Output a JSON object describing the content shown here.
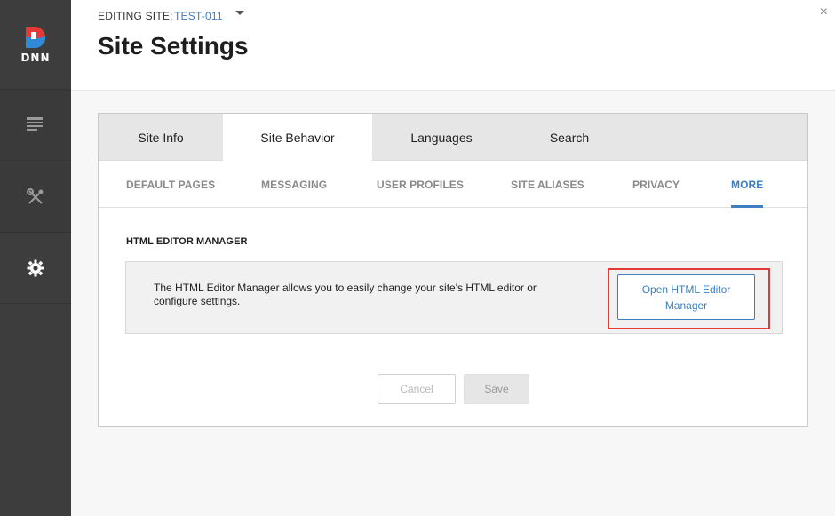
{
  "sidebar": {
    "logo_text": "DNN",
    "items": [
      {
        "icon": "content-list-icon"
      },
      {
        "icon": "tools-icon"
      },
      {
        "icon": "gear-icon"
      }
    ]
  },
  "header": {
    "editing_label": "EDITING SITE:",
    "site_name": "TEST-011",
    "title": "Site Settings",
    "close_glyph": "×"
  },
  "tabs": {
    "main": [
      "Site Info",
      "Site Behavior",
      "Languages",
      "Search"
    ],
    "active_main": "Site Behavior",
    "sub": [
      "DEFAULT PAGES",
      "MESSAGING",
      "USER PROFILES",
      "SITE ALIASES",
      "PRIVACY",
      "MORE"
    ],
    "active_sub": "MORE"
  },
  "section": {
    "title": "HTML EDITOR MANAGER",
    "description": "The HTML Editor Manager allows you to easily change your site's HTML editor or configure settings.",
    "button_label": "Open HTML Editor Manager"
  },
  "actions": {
    "cancel_label": "Cancel",
    "save_label": "Save"
  },
  "colors": {
    "accent": "#3c7ec1",
    "highlight": "#e53935",
    "sidebar_bg": "#3d3d3d"
  }
}
